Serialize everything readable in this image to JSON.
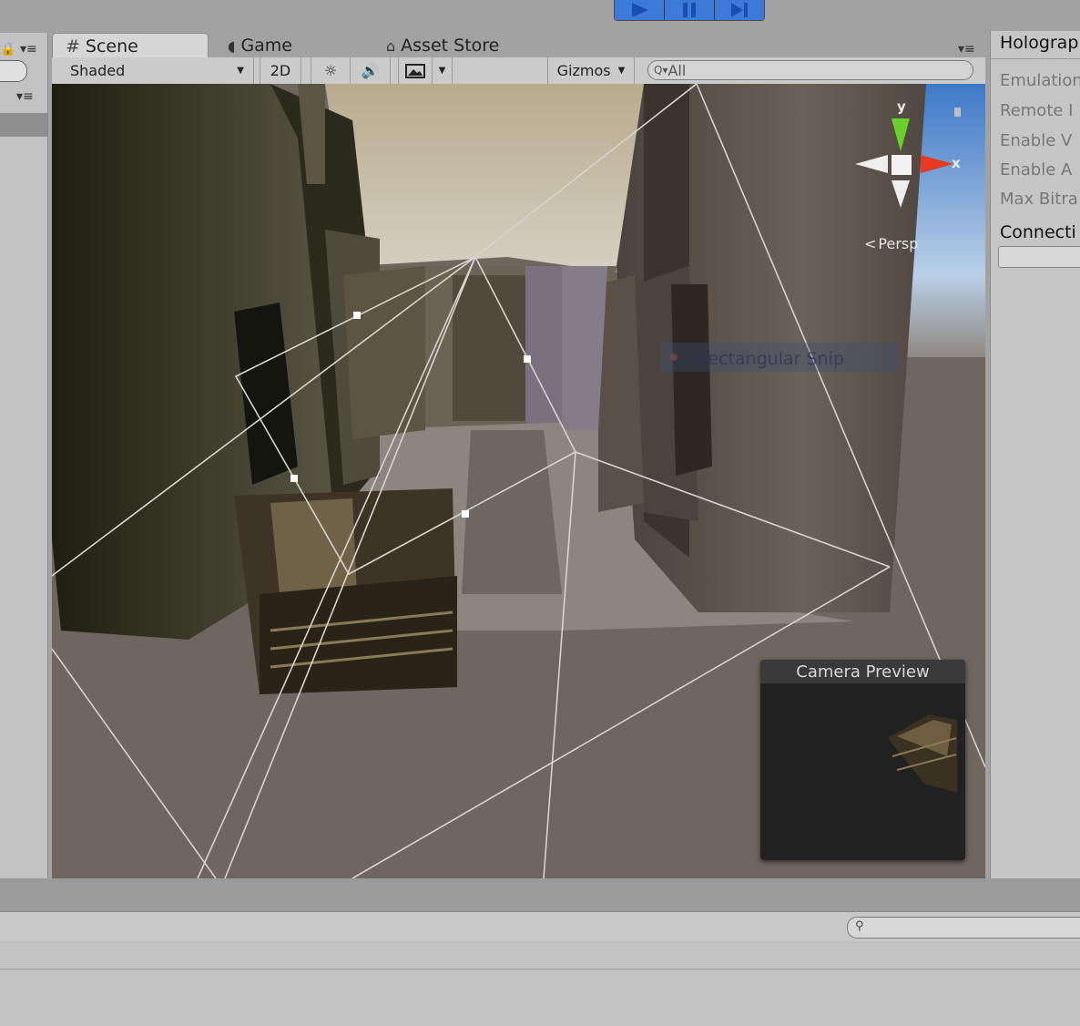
{
  "toolbar": {
    "play_icon": "play-icon",
    "pause_icon": "pause-icon",
    "step_icon": "step-icon",
    "accent": "#3d7ad8"
  },
  "tabs": {
    "scene": "Scene",
    "game": "Game",
    "asset_store": "Asset Store"
  },
  "scene_toolbar": {
    "shading_mode": "Shaded",
    "mode_2d": "2D",
    "gizmos": "Gizmos",
    "search_placeholder": "All"
  },
  "scene": {
    "persp_label": "Persp",
    "axis_y": "y",
    "axis_x": "x",
    "overlay_tooltip": "Rectangular Snip"
  },
  "camera_preview": {
    "title": "Camera Preview"
  },
  "inspector": {
    "title": "Holograp",
    "items": [
      "Emulation",
      "Remote I",
      "Enable V",
      "Enable A",
      "Max Bitra"
    ],
    "section": "Connecti"
  }
}
